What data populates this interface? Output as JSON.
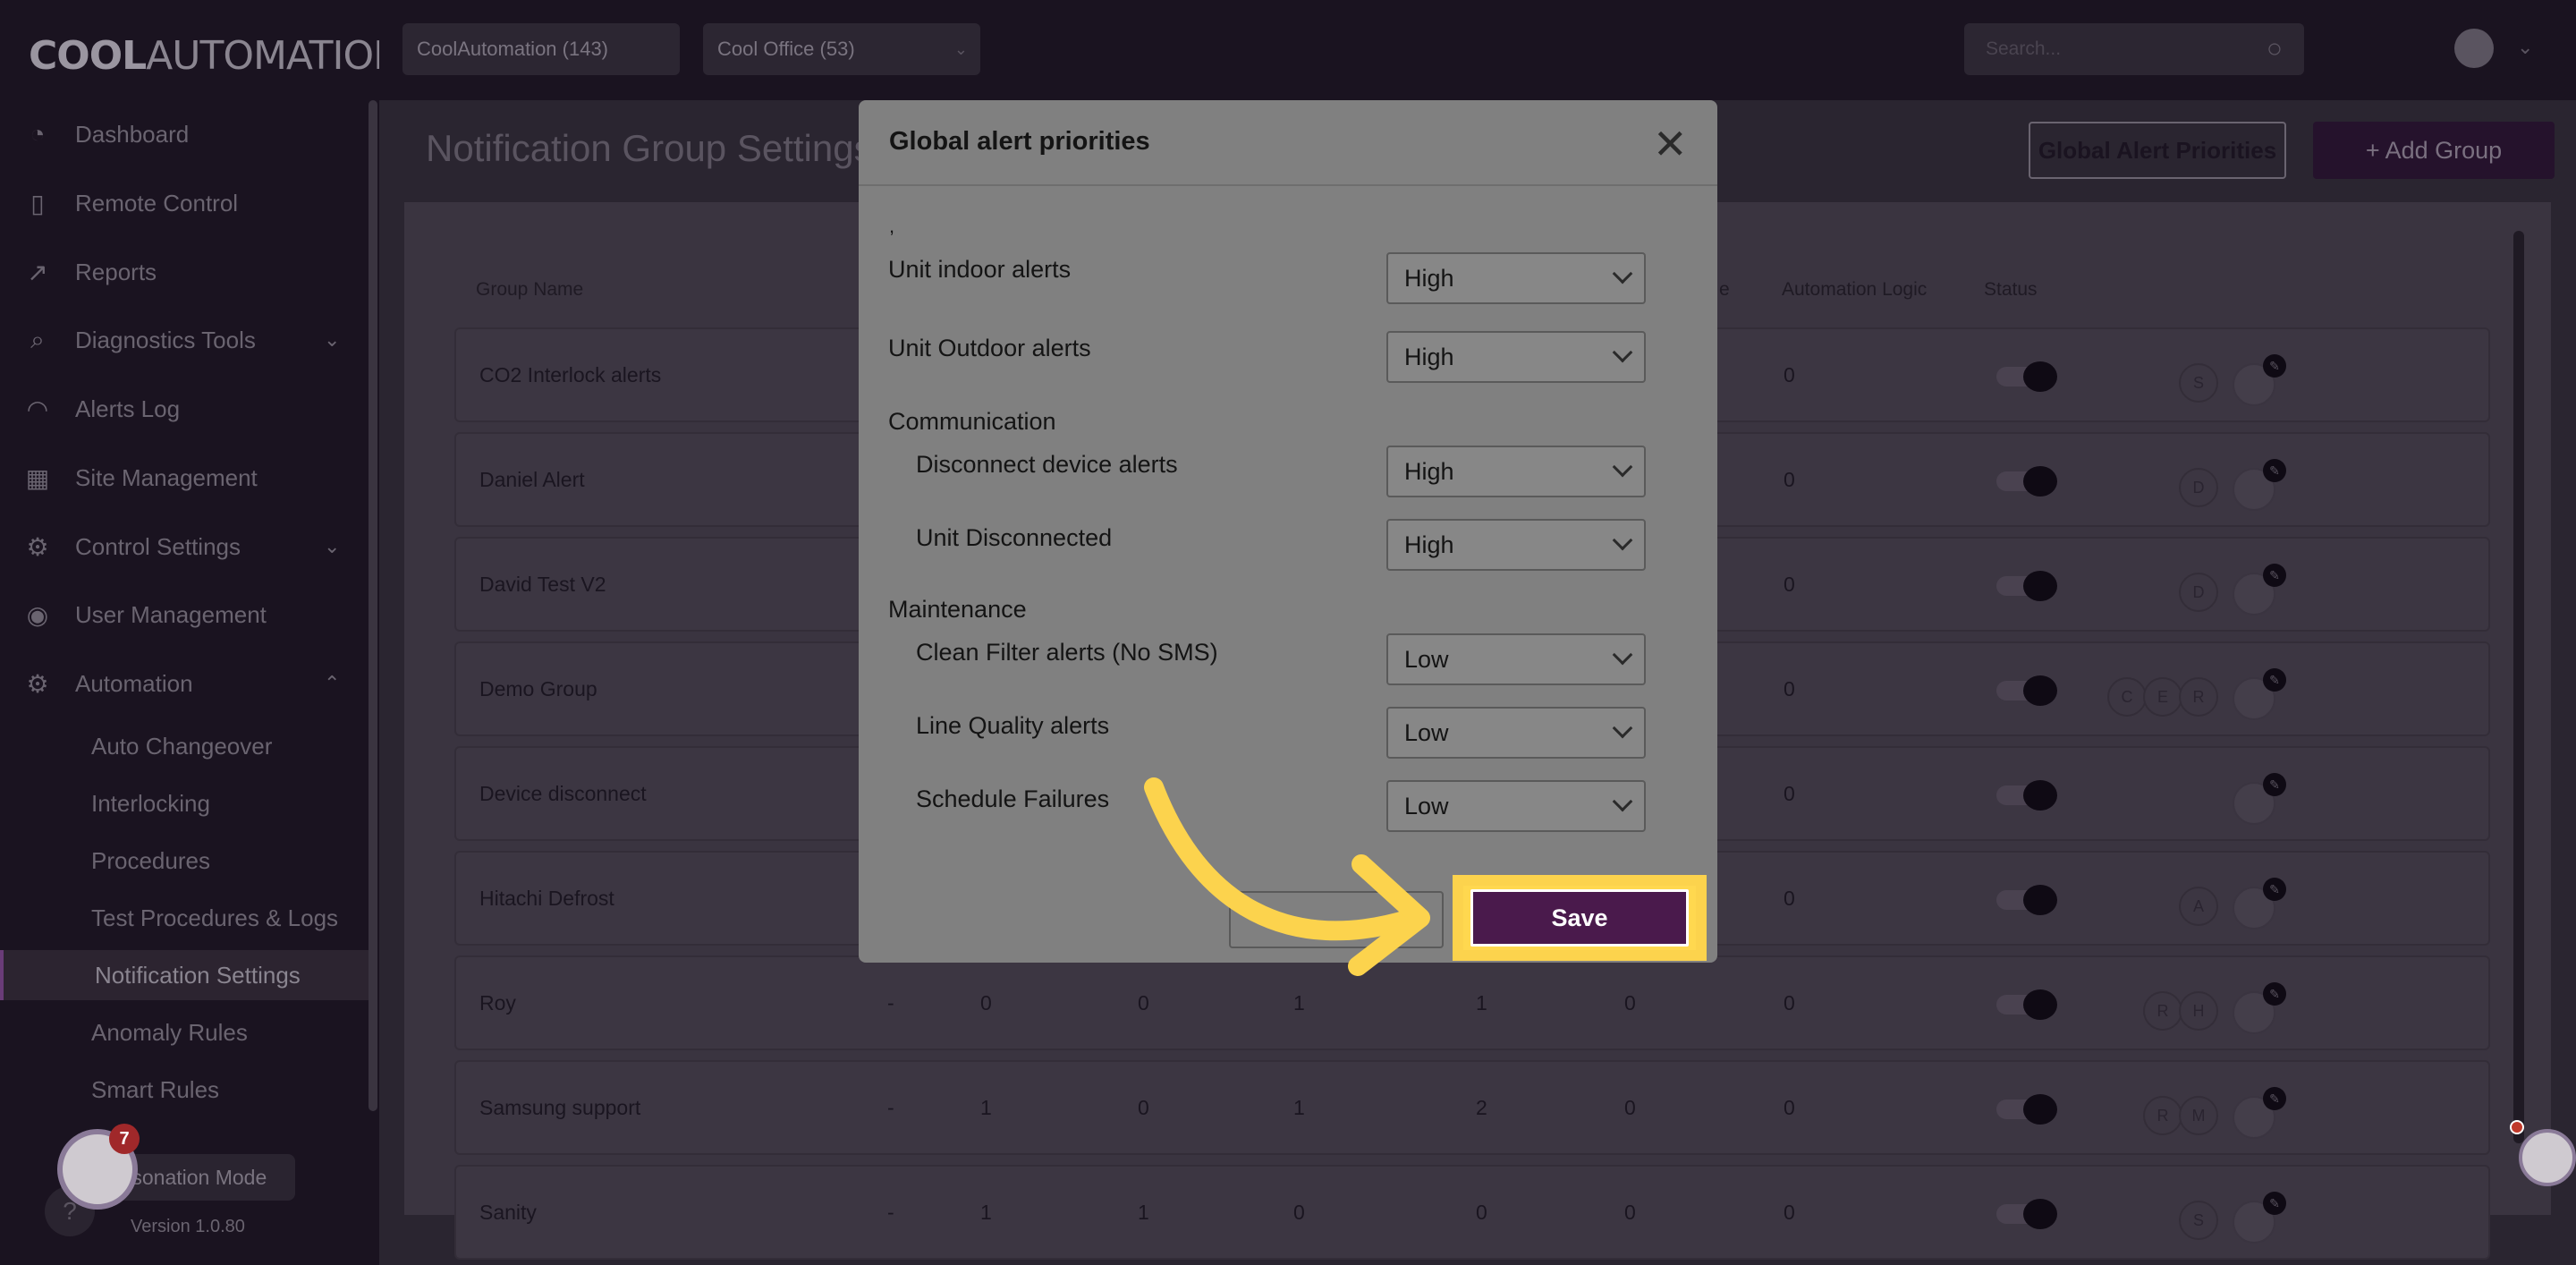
{
  "brand": {
    "name_bold": "COOL",
    "name_rest": "AUTOMATION"
  },
  "sidebar": {
    "items": [
      {
        "label": "Dashboard",
        "icon": "dashboard-icon"
      },
      {
        "label": "Remote Control",
        "icon": "remote-icon"
      },
      {
        "label": "Reports",
        "icon": "chart-icon"
      },
      {
        "label": "Diagnostics Tools",
        "icon": "diagnostics-icon"
      },
      {
        "label": "Alerts Log",
        "icon": "bell-icon"
      },
      {
        "label": "Site Management",
        "icon": "building-icon"
      },
      {
        "label": "Control Settings",
        "icon": "gear-icon"
      },
      {
        "label": "User Management",
        "icon": "user-icon"
      },
      {
        "label": "Automation",
        "icon": "automation-icon"
      }
    ],
    "subitems": [
      "Auto Changeover",
      "Interlocking",
      "Procedures",
      "Test Procedures & Logs",
      "Notification Settings",
      "Anomaly Rules",
      "Smart Rules"
    ],
    "impersonation": "rsonation Mode",
    "chat_badge": "7",
    "version": "Version 1.0.80"
  },
  "topbar": {
    "customer": "CoolAutomation (143)",
    "site": "Cool Office (53)",
    "search_placeholder": "Search..."
  },
  "page": {
    "title": "Notification Group Settings",
    "global_button": "Global Alert Priorities",
    "add_button": "+ Add Group",
    "headers": {
      "group_name": "Group Name",
      "partial": "e",
      "automation": "Automation Logic",
      "status": "Status"
    },
    "rows": [
      {
        "name": "CO2 Interlock alerts",
        "cols": [
          "",
          "",
          "",
          "",
          "",
          "",
          "0"
        ],
        "chips": [
          "S"
        ]
      },
      {
        "name": "Daniel Alert",
        "cols": [
          "",
          "",
          "",
          "",
          "",
          "",
          "0"
        ],
        "chips": [
          "D"
        ]
      },
      {
        "name": "David Test V2",
        "cols": [
          "",
          "",
          "",
          "",
          "",
          "",
          "0"
        ],
        "chips": [
          "D"
        ]
      },
      {
        "name": "Demo Group",
        "cols": [
          "",
          "",
          "",
          "",
          "",
          "",
          "0"
        ],
        "chips": [
          "C",
          "E",
          "R"
        ]
      },
      {
        "name": "Device disconnect",
        "cols": [
          "",
          "",
          "",
          "",
          "",
          "",
          "0"
        ],
        "chips": []
      },
      {
        "name": "Hitachi Defrost",
        "cols": [
          "",
          "",
          "",
          "",
          "",
          "",
          "0"
        ],
        "chips": [
          "A"
        ]
      },
      {
        "name": "Roy",
        "cols": [
          "-",
          "0",
          "0",
          "1",
          "1",
          "0",
          "0"
        ],
        "chips": [
          "R",
          "H"
        ]
      },
      {
        "name": "Samsung support",
        "cols": [
          "-",
          "1",
          "0",
          "1",
          "2",
          "0",
          "0"
        ],
        "chips": [
          "R",
          "M"
        ]
      },
      {
        "name": "Sanity",
        "cols": [
          "-",
          "1",
          "1",
          "0",
          "0",
          "0",
          "0"
        ],
        "chips": [
          "S"
        ]
      }
    ]
  },
  "modal": {
    "title": "Global alert priorities",
    "close": "✕",
    "comma": ",",
    "unit_indoor": {
      "label": "Unit indoor alerts",
      "value": "High"
    },
    "unit_outdoor": {
      "label": "Unit Outdoor alerts",
      "value": "High"
    },
    "communication": "Communication",
    "disconnect_device": {
      "label": "Disconnect device alerts",
      "value": "High"
    },
    "unit_disconnected": {
      "label": "Unit Disconnected",
      "value": "High"
    },
    "maintenance": "Maintenance",
    "clean_filter": {
      "label": "Clean Filter alerts (No SMS)",
      "value": "Low"
    },
    "line_quality": {
      "label": "Line Quality alerts",
      "value": "Low"
    },
    "schedule_failures": {
      "label": "Schedule Failures",
      "value": "Low"
    },
    "save": "Save"
  },
  "colors": {
    "highlight": "#fcd34d",
    "save_bg": "#4a1a4c",
    "arrow": "#fcd34d"
  }
}
